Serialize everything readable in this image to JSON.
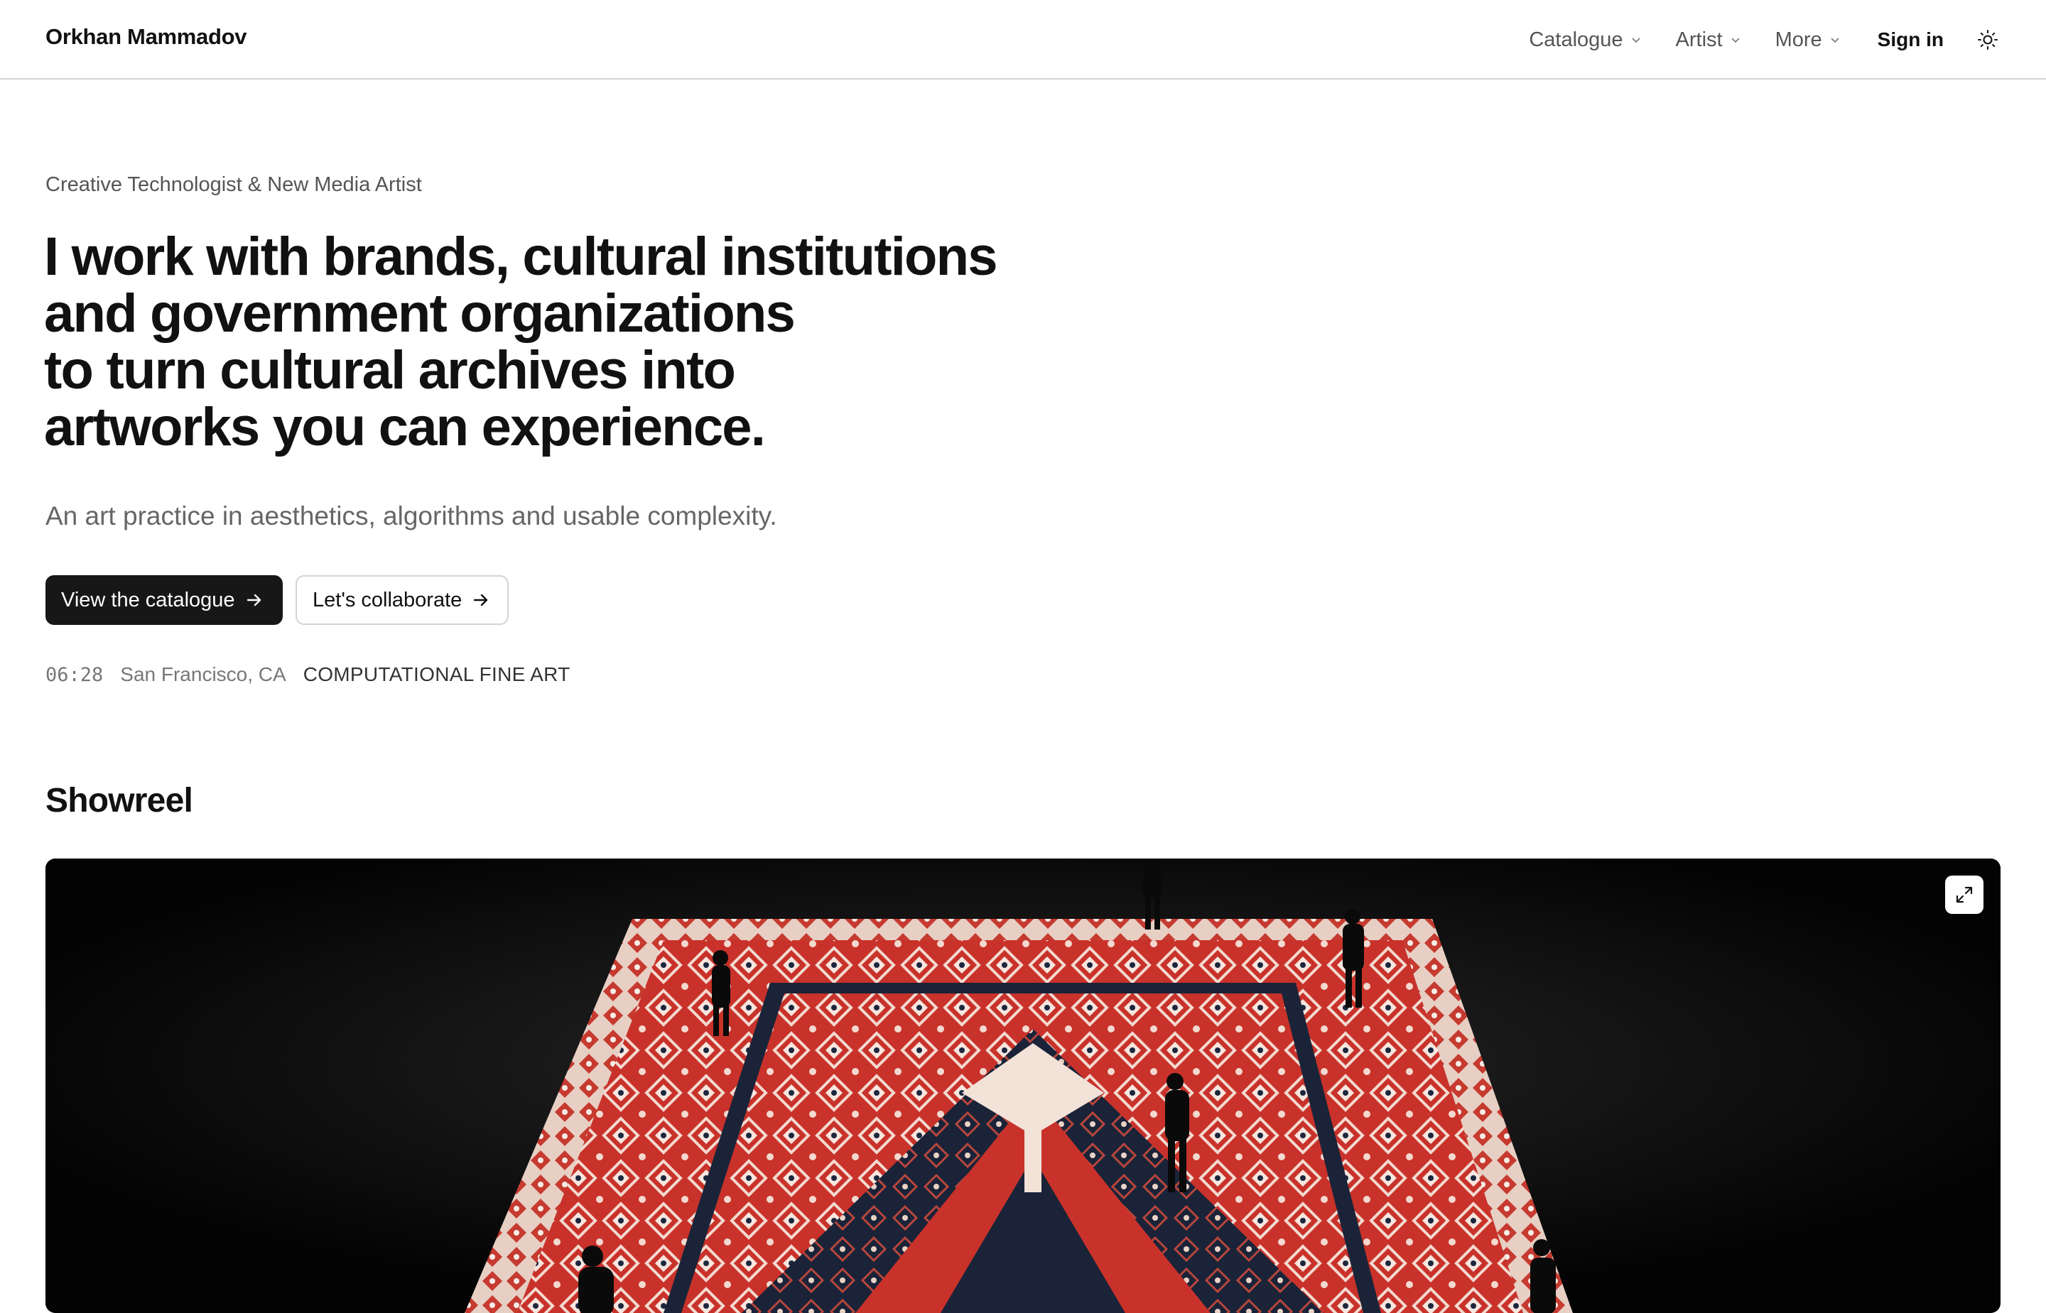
{
  "header": {
    "brand": "Orkhan Mammadov",
    "nav": [
      {
        "label": "Catalogue",
        "icon": "chevron-down-icon"
      },
      {
        "label": "Artist",
        "icon": "chevron-down-icon"
      },
      {
        "label": "More",
        "icon": "chevron-down-icon"
      }
    ],
    "sign_in": "Sign in",
    "theme_icon": "sun-icon"
  },
  "hero": {
    "eyebrow": "Creative Technologist & New Media Artist",
    "headline_lines": [
      "I work with brands, cultural institutions",
      "and government organizations",
      "to turn cultural archives into",
      "artworks you can experience."
    ],
    "subtitle": "An art practice in aesthetics, algorithms and usable complexity.",
    "primary_cta": "View the catalogue",
    "secondary_cta": "Let's collaborate",
    "cta_icon": "arrow-right-icon",
    "time": "06:28",
    "location": "San Francisco, CA",
    "tagline": "COMPUTATIONAL FINE ART"
  },
  "showreel": {
    "title": "Showreel",
    "expand_icon": "expand-icon"
  },
  "colors": {
    "text": "#111111",
    "muted": "#666666",
    "primary_button": "#171717",
    "border": "#d4d4d4",
    "carpet_red": "#c8322a",
    "video_bg": "#030303"
  }
}
